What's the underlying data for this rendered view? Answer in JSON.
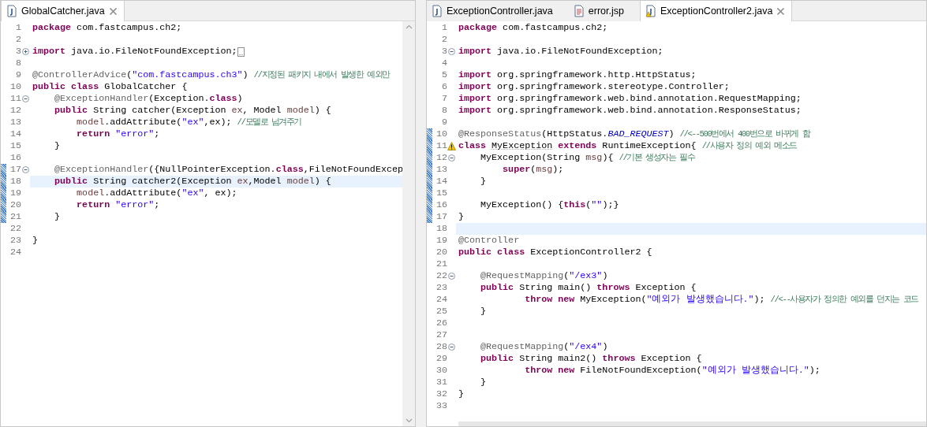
{
  "editors": [
    {
      "kind": "vertical-scroll",
      "tabs": [
        {
          "label": "GlobalCatcher.java",
          "kind": "java",
          "selected": true
        }
      ],
      "lines": [
        {
          "number": "1",
          "tokens": [
            {
              "kind": "kw",
              "text": "package"
            },
            {
              "kind": "plain",
              "text": " com.fastcampus.ch2;"
            }
          ]
        },
        {
          "number": "2"
        },
        {
          "number": "3",
          "expanded": false,
          "folded_marker": true,
          "tokens": [
            {
              "kind": "kw",
              "text": "import"
            },
            {
              "kind": "plain",
              "text": " java.io.FileNotFoundException;"
            }
          ]
        },
        {
          "number": "8"
        },
        {
          "number": "9",
          "tokens": [
            {
              "kind": "ann",
              "text": "@ControllerAdvice"
            },
            {
              "kind": "plain",
              "text": "("
            },
            {
              "kind": "str",
              "text": "\"com.fastcampus.ch3\""
            },
            {
              "kind": "plain",
              "text": ") "
            },
            {
              "kind": "com",
              "text": "//지정된 패키지 내에서 발생한 예외만"
            }
          ]
        },
        {
          "number": "10",
          "tokens": [
            {
              "kind": "kw",
              "text": "public class"
            },
            {
              "kind": "plain",
              "text": " GlobalCatcher {"
            }
          ]
        },
        {
          "number": "11",
          "expanded": true,
          "tokens": [
            {
              "kind": "ann",
              "text": "    @ExceptionHandler"
            },
            {
              "kind": "plain",
              "text": "(Exception."
            },
            {
              "kind": "kw",
              "text": "class"
            },
            {
              "kind": "plain",
              "text": ")"
            }
          ]
        },
        {
          "number": "12",
          "tokens": [
            {
              "kind": "kw",
              "text": "    public"
            },
            {
              "kind": "plain",
              "text": " String catcher(Exception "
            },
            {
              "kind": "var",
              "text": "ex"
            },
            {
              "kind": "plain",
              "text": ", Model "
            },
            {
              "kind": "var",
              "text": "model"
            },
            {
              "kind": "plain",
              "text": ") {"
            }
          ]
        },
        {
          "number": "13",
          "tokens": [
            {
              "kind": "var",
              "text": "        model"
            },
            {
              "kind": "plain",
              "text": ".addAttribute("
            },
            {
              "kind": "str",
              "text": "\"ex\""
            },
            {
              "kind": "plain",
              "text": ",ex); "
            },
            {
              "kind": "com",
              "text": "//모델로 넘겨주기"
            }
          ]
        },
        {
          "number": "14",
          "tokens": [
            {
              "kind": "kw",
              "text": "        return "
            },
            {
              "kind": "str",
              "text": "\"error\""
            },
            {
              "kind": "plain",
              "text": ";"
            }
          ]
        },
        {
          "number": "15",
          "tokens": [
            {
              "kind": "plain",
              "text": "    }"
            }
          ]
        },
        {
          "number": "16"
        },
        {
          "number": "17",
          "expanded": true,
          "changed": true,
          "tokens": [
            {
              "kind": "ann",
              "text": "    @ExceptionHandler"
            },
            {
              "kind": "plain",
              "text": "({NullPointerException."
            },
            {
              "kind": "kw",
              "text": "class"
            },
            {
              "kind": "plain",
              "text": ",FileNotFoundExcep"
            }
          ]
        },
        {
          "number": "18",
          "current": true,
          "changed": true,
          "tokens": [
            {
              "kind": "kw",
              "text": "    public"
            },
            {
              "kind": "plain",
              "text": " String catcher2(Exception "
            },
            {
              "kind": "var",
              "text": "ex"
            },
            {
              "kind": "plain",
              "text": ",Model "
            },
            {
              "kind": "var",
              "text": "model"
            },
            {
              "kind": "plain",
              "text": ") {"
            }
          ]
        },
        {
          "number": "19",
          "changed": true,
          "tokens": [
            {
              "kind": "var",
              "text": "        model"
            },
            {
              "kind": "plain",
              "text": ".addAttribute("
            },
            {
              "kind": "str",
              "text": "\"ex\""
            },
            {
              "kind": "plain",
              "text": ", ex);"
            }
          ]
        },
        {
          "number": "20",
          "changed": true,
          "tokens": [
            {
              "kind": "kw",
              "text": "        return "
            },
            {
              "kind": "str",
              "text": "\"error\""
            },
            {
              "kind": "plain",
              "text": ";"
            }
          ]
        },
        {
          "number": "21",
          "changed": true,
          "tokens": [
            {
              "kind": "plain",
              "text": "    }"
            }
          ]
        },
        {
          "number": "22"
        },
        {
          "number": "23",
          "tokens": [
            {
              "kind": "plain",
              "text": "}"
            }
          ]
        },
        {
          "number": "24"
        }
      ]
    },
    {
      "kind": "horizontal-scroll",
      "tabs": [
        {
          "label": "ExceptionController.java",
          "kind": "java",
          "selected": false
        },
        {
          "label": "error.jsp",
          "kind": "jsp",
          "selected": false
        },
        {
          "label": "ExceptionController2.java",
          "kind": "java-warning",
          "selected": true
        }
      ],
      "lines": [
        {
          "number": "1",
          "tokens": [
            {
              "kind": "kw",
              "text": "package"
            },
            {
              "kind": "plain",
              "text": " com.fastcampus.ch2;"
            }
          ]
        },
        {
          "number": "2"
        },
        {
          "number": "3",
          "expanded": true,
          "tokens": [
            {
              "kind": "kw",
              "text": "import"
            },
            {
              "kind": "plain",
              "text": " java.io.FileNotFoundException;"
            }
          ]
        },
        {
          "number": "4"
        },
        {
          "number": "5",
          "tokens": [
            {
              "kind": "kw",
              "text": "import"
            },
            {
              "kind": "plain",
              "text": " org.springframework.http.HttpStatus;"
            }
          ]
        },
        {
          "number": "6",
          "tokens": [
            {
              "kind": "kw",
              "text": "import"
            },
            {
              "kind": "plain",
              "text": " org.springframework.stereotype.Controller;"
            }
          ]
        },
        {
          "number": "7",
          "tokens": [
            {
              "kind": "kw",
              "text": "import"
            },
            {
              "kind": "plain",
              "text": " org.springframework.web.bind.annotation.RequestMapping;"
            }
          ]
        },
        {
          "number": "8",
          "tokens": [
            {
              "kind": "kw",
              "text": "import"
            },
            {
              "kind": "plain",
              "text": " org.springframework.web.bind.annotation.ResponseStatus;"
            }
          ]
        },
        {
          "number": "9"
        },
        {
          "number": "10",
          "changed": true,
          "tokens": [
            {
              "kind": "ann",
              "text": "@ResponseStatus"
            },
            {
              "kind": "plain",
              "text": "(HttpStatus."
            },
            {
              "kind": "static",
              "text": "BAD_REQUEST"
            },
            {
              "kind": "plain",
              "text": ") "
            },
            {
              "kind": "com",
              "text": "//<--500번에서 400번으로 바뀌게 함"
            }
          ]
        },
        {
          "number": "11",
          "changed": true,
          "warning": true,
          "tokens": [
            {
              "kind": "kw",
              "text": "class "
            },
            {
              "kind": "warn",
              "text": "MyException"
            },
            {
              "kind": "kw",
              "text": " extends"
            },
            {
              "kind": "plain",
              "text": " RuntimeException{ "
            },
            {
              "kind": "com",
              "text": "//사용자 정의 예외 메소드"
            }
          ]
        },
        {
          "number": "12",
          "expanded": true,
          "changed": true,
          "tokens": [
            {
              "kind": "plain",
              "text": "    MyException(String "
            },
            {
              "kind": "var",
              "text": "msg"
            },
            {
              "kind": "plain",
              "text": "){ "
            },
            {
              "kind": "com",
              "text": "//기본 생성자는 필수"
            }
          ]
        },
        {
          "number": "13",
          "changed": true,
          "tokens": [
            {
              "kind": "kw",
              "text": "        super"
            },
            {
              "kind": "plain",
              "text": "("
            },
            {
              "kind": "var",
              "text": "msg"
            },
            {
              "kind": "plain",
              "text": ");"
            }
          ]
        },
        {
          "number": "14",
          "changed": true,
          "tokens": [
            {
              "kind": "plain",
              "text": "    }"
            }
          ]
        },
        {
          "number": "15",
          "changed": true
        },
        {
          "number": "16",
          "changed": true,
          "tokens": [
            {
              "kind": "plain",
              "text": "    MyException() {"
            },
            {
              "kind": "kw",
              "text": "this"
            },
            {
              "kind": "plain",
              "text": "("
            },
            {
              "kind": "str",
              "text": "\"\""
            },
            {
              "kind": "plain",
              "text": ");}"
            }
          ]
        },
        {
          "number": "17",
          "changed": true,
          "tokens": [
            {
              "kind": "plain",
              "text": "}"
            }
          ]
        },
        {
          "number": "18",
          "current": true
        },
        {
          "number": "19",
          "tokens": [
            {
              "kind": "ann",
              "text": "@Controller"
            }
          ]
        },
        {
          "number": "20",
          "tokens": [
            {
              "kind": "kw",
              "text": "public class"
            },
            {
              "kind": "plain",
              "text": " ExceptionController2 {"
            }
          ]
        },
        {
          "number": "21"
        },
        {
          "number": "22",
          "expanded": true,
          "tokens": [
            {
              "kind": "ann",
              "text": "    @RequestMapping"
            },
            {
              "kind": "plain",
              "text": "("
            },
            {
              "kind": "str",
              "text": "\"/ex3\""
            },
            {
              "kind": "plain",
              "text": ")"
            }
          ]
        },
        {
          "number": "23",
          "tokens": [
            {
              "kind": "kw",
              "text": "    public"
            },
            {
              "kind": "plain",
              "text": " String main() "
            },
            {
              "kind": "kw",
              "text": "throws"
            },
            {
              "kind": "plain",
              "text": " Exception {"
            }
          ]
        },
        {
          "number": "24",
          "tokens": [
            {
              "kind": "kw",
              "text": "            throw new"
            },
            {
              "kind": "plain",
              "text": " MyException("
            },
            {
              "kind": "str",
              "text": "\"예외가 발생했습니다.\""
            },
            {
              "kind": "plain",
              "text": "); "
            },
            {
              "kind": "com",
              "text": "//<--사용자가 정의한 예외를 던지는 코드"
            }
          ]
        },
        {
          "number": "25",
          "tokens": [
            {
              "kind": "plain",
              "text": "    }"
            }
          ]
        },
        {
          "number": "26"
        },
        {
          "number": "27"
        },
        {
          "number": "28",
          "expanded": true,
          "tokens": [
            {
              "kind": "ann",
              "text": "    @RequestMapping"
            },
            {
              "kind": "plain",
              "text": "("
            },
            {
              "kind": "str",
              "text": "\"/ex4\""
            },
            {
              "kind": "plain",
              "text": ")"
            }
          ]
        },
        {
          "number": "29",
          "tokens": [
            {
              "kind": "kw",
              "text": "    public"
            },
            {
              "kind": "plain",
              "text": " String main2() "
            },
            {
              "kind": "kw",
              "text": "throws"
            },
            {
              "kind": "plain",
              "text": " Exception {"
            }
          ]
        },
        {
          "number": "30",
          "tokens": [
            {
              "kind": "kw",
              "text": "            throw new"
            },
            {
              "kind": "plain",
              "text": " FileNotFoundException("
            },
            {
              "kind": "str",
              "text": "\"예외가 발생했습니다.\""
            },
            {
              "kind": "plain",
              "text": ");"
            }
          ]
        },
        {
          "number": "31",
          "tokens": [
            {
              "kind": "plain",
              "text": "    }"
            }
          ]
        },
        {
          "number": "32",
          "tokens": [
            {
              "kind": "plain",
              "text": "}"
            }
          ]
        },
        {
          "number": "33"
        }
      ]
    }
  ]
}
